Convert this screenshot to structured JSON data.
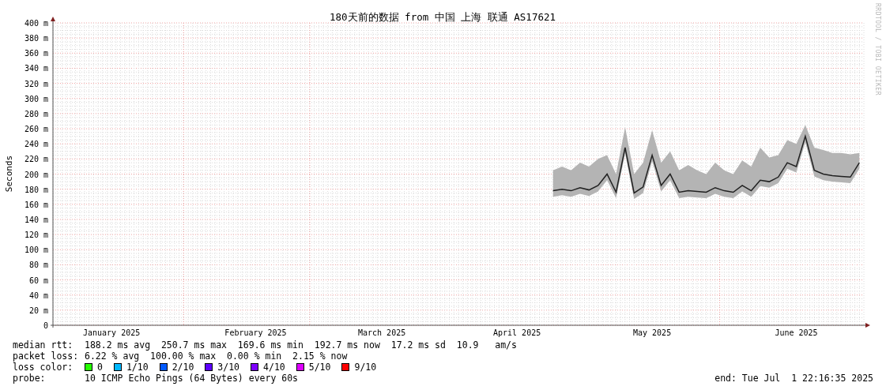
{
  "watermark_side": "RRDTOOL / TOBI OETIKER",
  "chart": {
    "chart_data": {
      "type": "line",
      "title": "180天前的数据 from 中国 上海 联通 AS17621",
      "ylabel": "Seconds",
      "grid": true,
      "ylim": [
        0,
        400
      ],
      "categories": [
        null,
        null,
        null,
        null,
        null,
        null,
        "January 2025",
        null,
        null,
        null,
        null,
        null,
        null,
        null,
        null,
        null,
        null,
        null,
        null,
        null,
        null,
        null,
        "February 2025",
        null,
        null,
        null,
        null,
        null,
        null,
        null,
        null,
        null,
        null,
        null,
        null,
        null,
        "March 2025",
        null,
        null,
        null,
        null,
        null,
        null,
        null,
        null,
        null,
        null,
        null,
        null,
        null,
        null,
        "April 2025",
        null,
        null,
        null,
        null,
        null,
        null,
        null,
        null,
        null,
        null,
        null,
        null,
        null,
        null,
        "May 2025",
        null,
        null,
        null,
        null,
        null,
        null,
        null,
        null,
        null,
        null,
        null,
        null,
        null,
        null,
        null,
        "June 2025",
        null,
        null,
        null,
        null,
        null,
        null,
        null
      ],
      "yticks": [
        {
          "value": 0,
          "label": "0"
        },
        {
          "value": 20,
          "label": "20 m"
        },
        {
          "value": 40,
          "label": "40 m"
        },
        {
          "value": 60,
          "label": "60 m"
        },
        {
          "value": 80,
          "label": "80 m"
        },
        {
          "value": 100,
          "label": "100 m"
        },
        {
          "value": 120,
          "label": "120 m"
        },
        {
          "value": 140,
          "label": "140 m"
        },
        {
          "value": 160,
          "label": "160 m"
        },
        {
          "value": 180,
          "label": "180 m"
        },
        {
          "value": 200,
          "label": "200 m"
        },
        {
          "value": 220,
          "label": "220 m"
        },
        {
          "value": 240,
          "label": "240 m"
        },
        {
          "value": 260,
          "label": "260 m"
        },
        {
          "value": 280,
          "label": "280 m"
        },
        {
          "value": 300,
          "label": "300 m"
        },
        {
          "value": 320,
          "label": "320 m"
        },
        {
          "value": 340,
          "label": "340 m"
        },
        {
          "value": 360,
          "label": "360 m"
        },
        {
          "value": 380,
          "label": "380 m"
        },
        {
          "value": 400,
          "label": "400 m"
        }
      ],
      "series": [
        {
          "type": "area",
          "color": "#b4b4b4",
          "values": [
            null,
            null,
            null,
            null,
            null,
            null,
            null,
            null,
            null,
            null,
            null,
            null,
            null,
            null,
            null,
            null,
            null,
            null,
            null,
            null,
            null,
            null,
            null,
            null,
            null,
            null,
            null,
            null,
            null,
            null,
            null,
            null,
            null,
            null,
            null,
            null,
            null,
            null,
            null,
            null,
            null,
            null,
            null,
            null,
            null,
            null,
            null,
            null,
            null,
            null,
            null,
            null,
            null,
            null,
            null,
            205,
            210,
            205,
            215,
            210,
            220,
            225,
            200,
            262,
            200,
            215,
            258,
            215,
            230,
            205,
            212,
            205,
            200,
            215,
            205,
            200,
            218,
            210,
            235,
            222,
            225,
            245,
            240,
            265,
            235,
            232,
            228,
            228,
            226,
            228
          ]
        },
        {
          "type": "line",
          "color": "#202020",
          "values": [
            null,
            null,
            null,
            null,
            null,
            null,
            null,
            null,
            null,
            null,
            null,
            null,
            null,
            null,
            null,
            null,
            null,
            null,
            null,
            null,
            null,
            null,
            null,
            null,
            null,
            null,
            null,
            null,
            null,
            null,
            null,
            null,
            null,
            null,
            null,
            null,
            null,
            null,
            null,
            null,
            null,
            null,
            null,
            null,
            null,
            null,
            null,
            null,
            null,
            null,
            null,
            null,
            null,
            null,
            null,
            178,
            180,
            178,
            182,
            179,
            185,
            200,
            176,
            235,
            175,
            183,
            225,
            185,
            200,
            176,
            178,
            177,
            176,
            182,
            178,
            176,
            185,
            178,
            192,
            190,
            196,
            215,
            210,
            250,
            205,
            200,
            198,
            197,
            196,
            215
          ]
        }
      ]
    }
  },
  "legend": [
    {
      "kind": "text",
      "label": "median rtt:",
      "value": "188.2 ms avg  250.7 ms max  169.6 ms min  192.7 ms now  17.2 ms sd  10.9   am/s"
    },
    {
      "kind": "text",
      "label": "packet loss:",
      "value": "6.22 % avg  100.00 % max  0.00 % min  2.15 % now"
    },
    {
      "kind": "colors",
      "label": "loss color:",
      "items": [
        {
          "label": "0",
          "color": "#26ff00"
        },
        {
          "label": "1/10",
          "color": "#00b8ff"
        },
        {
          "label": "2/10",
          "color": "#0059ff"
        },
        {
          "label": "3/10",
          "color": "#5e00ff"
        },
        {
          "label": "4/10",
          "color": "#7e00ff"
        },
        {
          "label": "5/10",
          "color": "#dd00ff"
        },
        {
          "label": "9/10",
          "color": "#ff0000"
        }
      ]
    },
    {
      "kind": "probe",
      "label": "probe:",
      "value": "10 ICMP Echo Pings (64 Bytes) every 60s",
      "end": "end: Tue Jul  1 22:16:35 2025"
    }
  ]
}
